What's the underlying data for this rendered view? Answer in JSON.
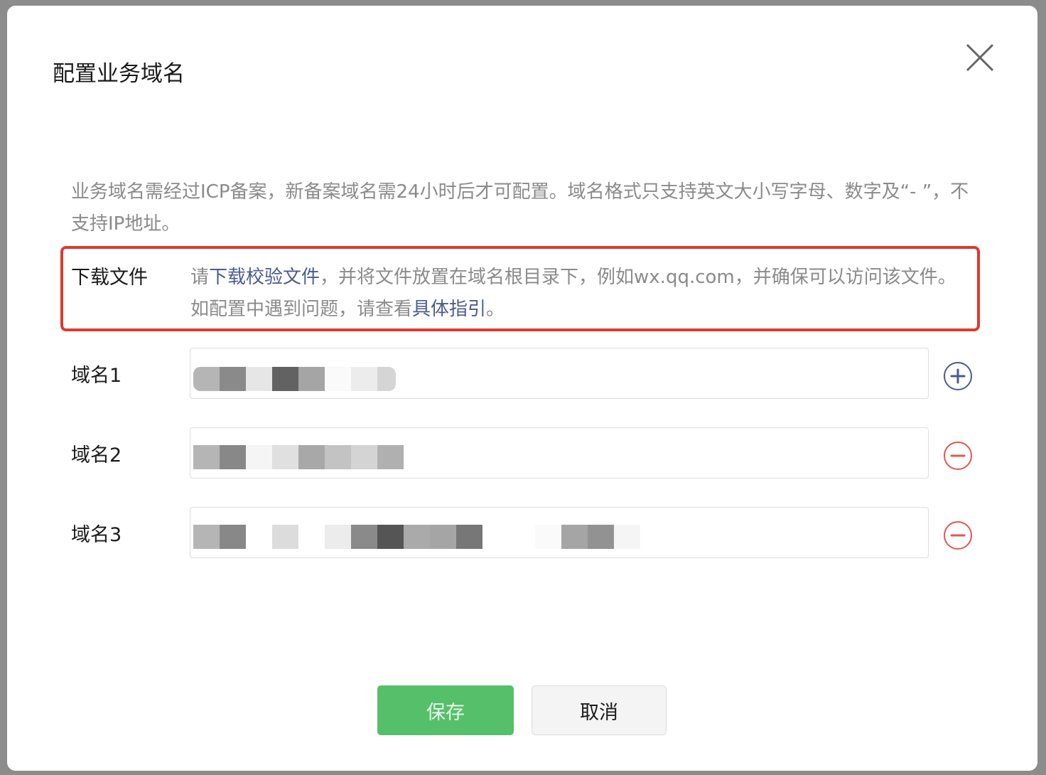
{
  "dialog": {
    "title": "配置业务域名",
    "description": "业务域名需经过ICP备案，新备案域名需24小时后才可配置。域名格式只支持英文大小写字母、数字及“- ”，不支持IP地址。",
    "download": {
      "label": "下载文件",
      "text_1": "请",
      "link_1": "下载校验文件",
      "text_2": "，并将文件放置在域名根目录下，例如wx.qq.com，并确保可以访问该文件。如配置中遇到问题，请查看",
      "link_2": "具体指引",
      "text_3": "。"
    },
    "domains": [
      {
        "label": "域名1",
        "value_blurred": true,
        "action": "add"
      },
      {
        "label": "域名2",
        "value_blurred": true,
        "action": "remove"
      },
      {
        "label": "域名3",
        "value_blurred": true,
        "action": "remove"
      }
    ],
    "buttons": {
      "save": "保存",
      "cancel": "取消"
    },
    "colors": {
      "highlight": "#e0392b",
      "link": "#4b5b8f",
      "save": "#56bf6a",
      "remove": "#e0584f",
      "add": "#4b5b8f"
    }
  }
}
